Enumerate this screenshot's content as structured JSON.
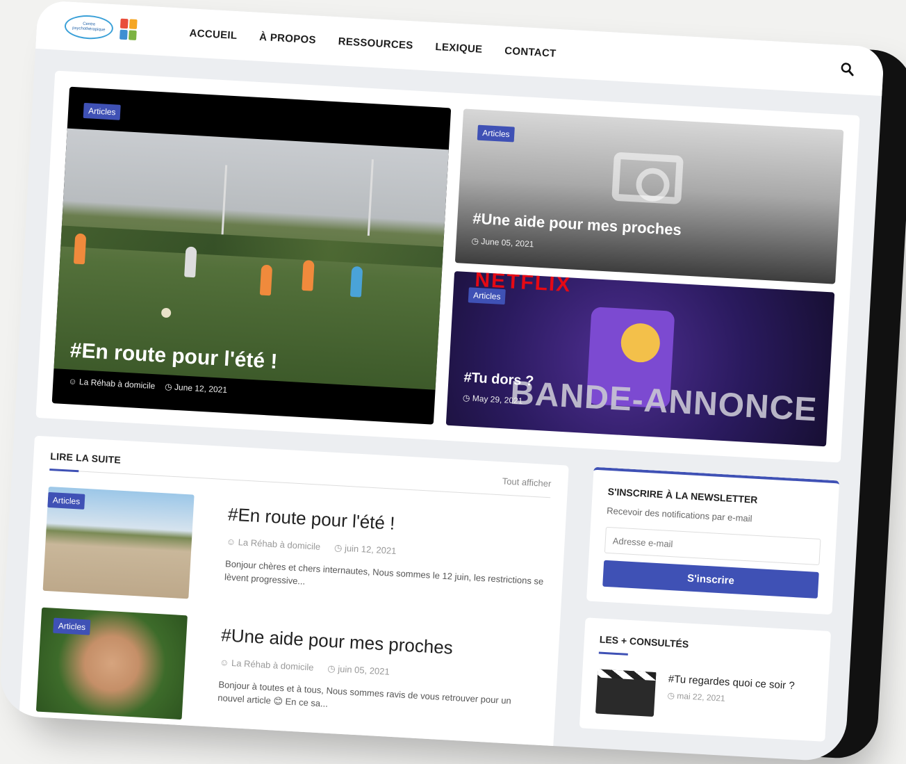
{
  "header": {
    "logo_text": "Centre psychothérapique",
    "nav": [
      "ACCUEIL",
      "À PROPOS",
      "RESSOURCES",
      "LEXIQUE",
      "CONTACT"
    ]
  },
  "featured": {
    "main": {
      "badge": "Articles",
      "title": "#En route pour l'été !",
      "author": "La Réhab à domicile",
      "date": "June 12, 2021"
    },
    "top_right": {
      "badge": "Articles",
      "title": "#Une aide pour mes proches",
      "date": "June 05, 2021"
    },
    "bottom_right": {
      "badge": "Articles",
      "title": "#Tu dors ?",
      "date": "May 29, 2021",
      "image_text_top": "NETFLIX",
      "image_text_bottom": "BANDE-ANNONCE"
    }
  },
  "read_more": {
    "title": "LIRE LA SUITE",
    "see_all": "Tout afficher",
    "posts": [
      {
        "badge": "Articles",
        "title": "#En route pour l'été !",
        "author": "La Réhab à domicile",
        "date": "juin 12, 2021",
        "excerpt": "Bonjour chères et chers internautes, Nous sommes le 12 juin, les restrictions se lèvent progressive..."
      },
      {
        "badge": "Articles",
        "title": "#Une aide pour mes proches",
        "author": "La Réhab à domicile",
        "date": "juin 05, 2021",
        "excerpt": "Bonjour à toutes et à tous,  Nous sommes ravis de vous retrouver pour un nouvel article 😊 En ce sa..."
      }
    ]
  },
  "newsletter": {
    "title": "S'INSCRIRE À LA NEWSLETTER",
    "subtitle": "Recevoir des notifications par e-mail",
    "placeholder": "Adresse e-mail",
    "button": "S'inscrire"
  },
  "popular": {
    "title": "LES + CONSULTÉS",
    "items": [
      {
        "title": "#Tu regardes quoi ce soir ?",
        "date": "mai 22, 2021"
      }
    ]
  },
  "colors": {
    "accent": "#3f51b5"
  }
}
